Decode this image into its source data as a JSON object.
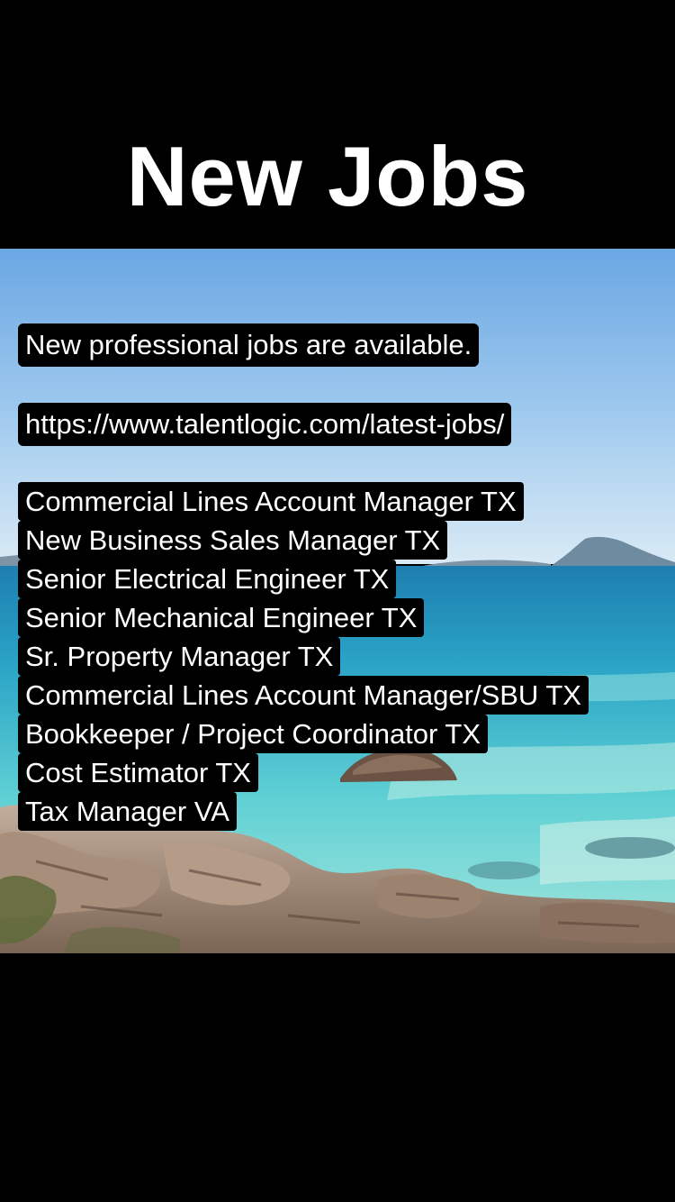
{
  "title": "New Jobs",
  "intro": "New professional jobs are available.",
  "url": "https://www.talentlogic.com/latest-jobs/",
  "jobs": [
    "Commercial Lines Account Manager TX",
    "New Business Sales Manager TX",
    "Senior Electrical Engineer TX",
    "Senior Mechanical Engineer TX",
    "Sr. Property Manager TX",
    "Commercial Lines Account Manager/SBU TX",
    "Bookkeeper / Project Coordinator TX",
    "Cost Estimator TX",
    "Tax Manager VA"
  ],
  "colors": {
    "background": "#000000",
    "text": "#ffffff",
    "caption_bg": "#000000",
    "sky": "#8ec1ea",
    "sea": "#37b3c8",
    "rocks": "#9a8474"
  }
}
